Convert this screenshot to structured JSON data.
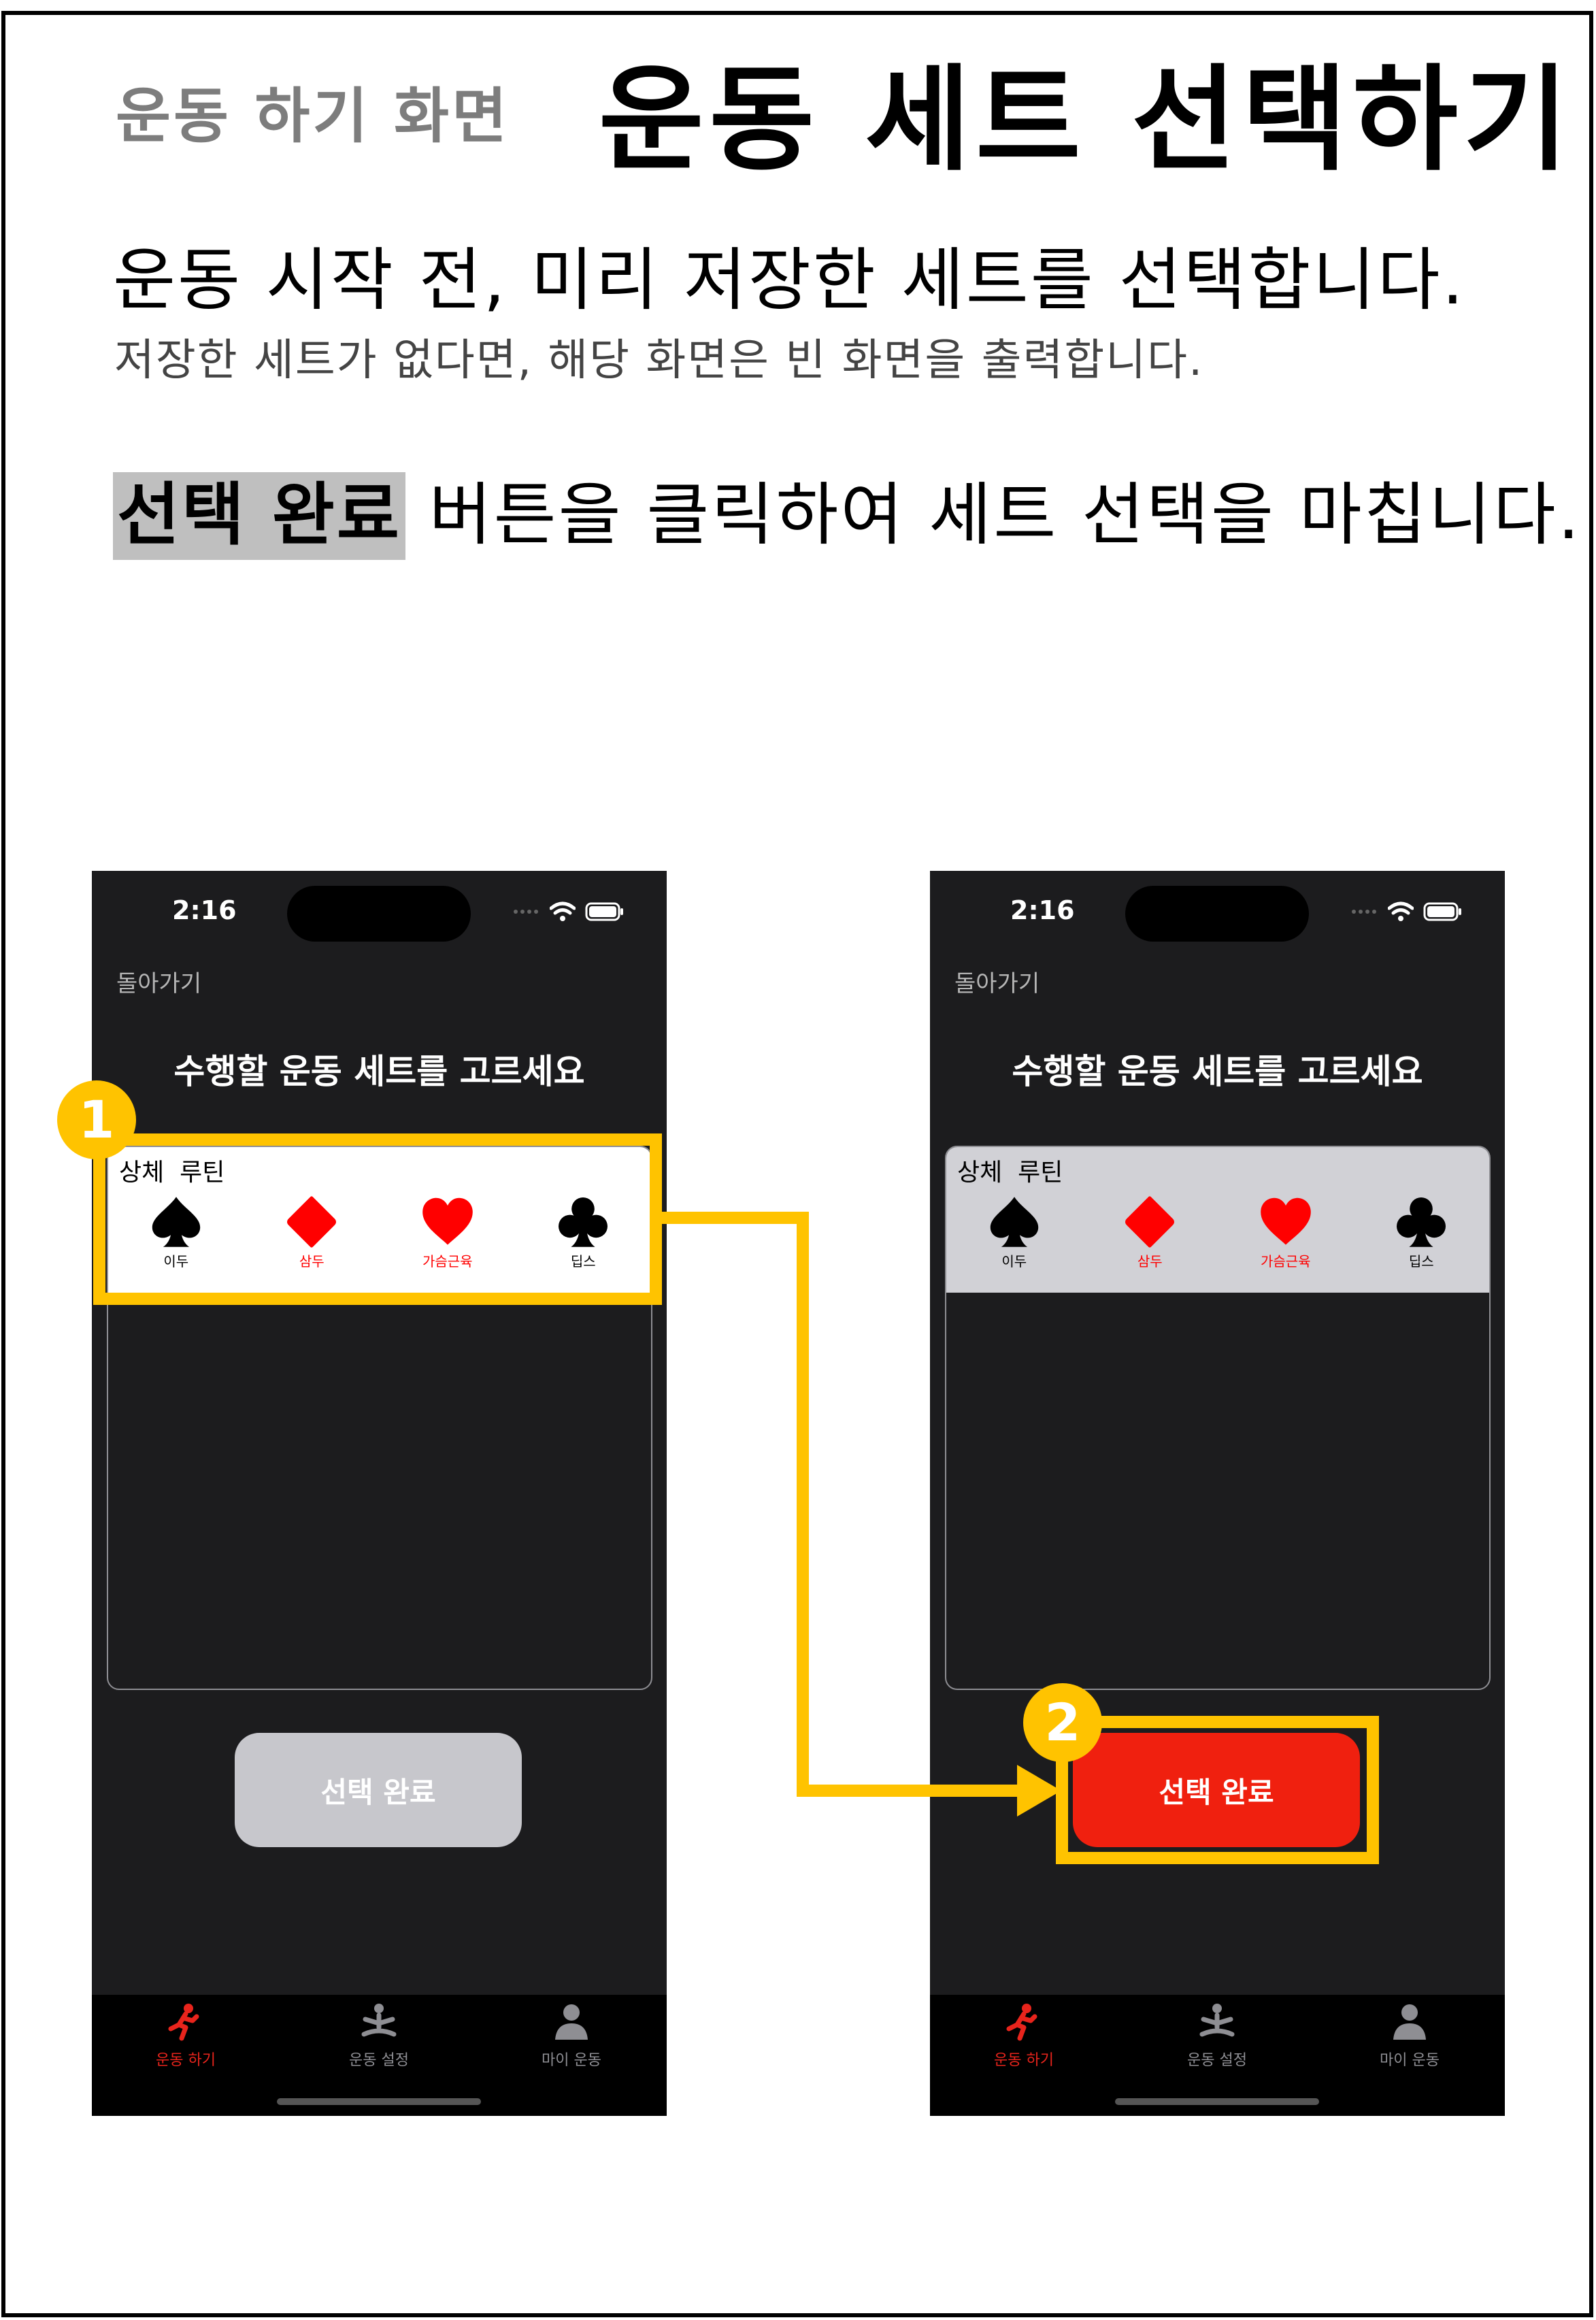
{
  "header": {
    "section_label": "운동 하기 화면",
    "title": "운동 세트 선택하기"
  },
  "description": {
    "line1": "운동 시작 전, 미리 저장한 세트를 선택합니다.",
    "line2": "저장한 세트가 없다면, 해당 화면은 빈 화면을 출력합니다.",
    "line3_highlight": "선택 완료",
    "line3_rest": " 버튼을 클릭하여 세트 선택을 마칩니다."
  },
  "annotations": {
    "step1": "1",
    "step2": "2",
    "accent_color": "#ffc300"
  },
  "screens": [
    {
      "state": "before-selection",
      "status_time": "2:16",
      "back_label": "돌아가기",
      "title": "수행할 운동 세트를 고르세요",
      "set_card": {
        "name": "상체  루틴",
        "exercises": [
          {
            "label": "이두",
            "icon": "spade-icon",
            "color": "#000000"
          },
          {
            "label": "삼두",
            "icon": "diamond-icon",
            "color": "#ff0000"
          },
          {
            "label": "가슴근육",
            "icon": "heart-icon",
            "color": "#ff0000"
          },
          {
            "label": "딥스",
            "icon": "club-icon",
            "color": "#000000"
          }
        ]
      },
      "done_button": {
        "label": "선택 완료",
        "enabled": false,
        "color": "#c7c7cc"
      },
      "tabs": [
        {
          "label": "운동 하기",
          "icon": "running-icon",
          "active": true
        },
        {
          "label": "운동 설정",
          "icon": "meditation-icon",
          "active": false
        },
        {
          "label": "마이 운동",
          "icon": "person-icon",
          "active": false
        }
      ]
    },
    {
      "state": "after-selection",
      "status_time": "2:16",
      "back_label": "돌아가기",
      "title": "수행할 운동 세트를 고르세요",
      "set_card": {
        "name": "상체  루틴",
        "exercises": [
          {
            "label": "이두",
            "icon": "spade-icon",
            "color": "#000000"
          },
          {
            "label": "삼두",
            "icon": "diamond-icon",
            "color": "#ff0000"
          },
          {
            "label": "가슴근육",
            "icon": "heart-icon",
            "color": "#ff0000"
          },
          {
            "label": "딥스",
            "icon": "club-icon",
            "color": "#000000"
          }
        ]
      },
      "done_button": {
        "label": "선택 완료",
        "enabled": true,
        "color": "#f0200f"
      },
      "tabs": [
        {
          "label": "운동 하기",
          "icon": "running-icon",
          "active": true
        },
        {
          "label": "운동 설정",
          "icon": "meditation-icon",
          "active": false
        },
        {
          "label": "마이 운동",
          "icon": "person-icon",
          "active": false
        }
      ]
    }
  ],
  "colors": {
    "tab_active": "#e8241c",
    "tab_inactive": "#8e8e93"
  }
}
